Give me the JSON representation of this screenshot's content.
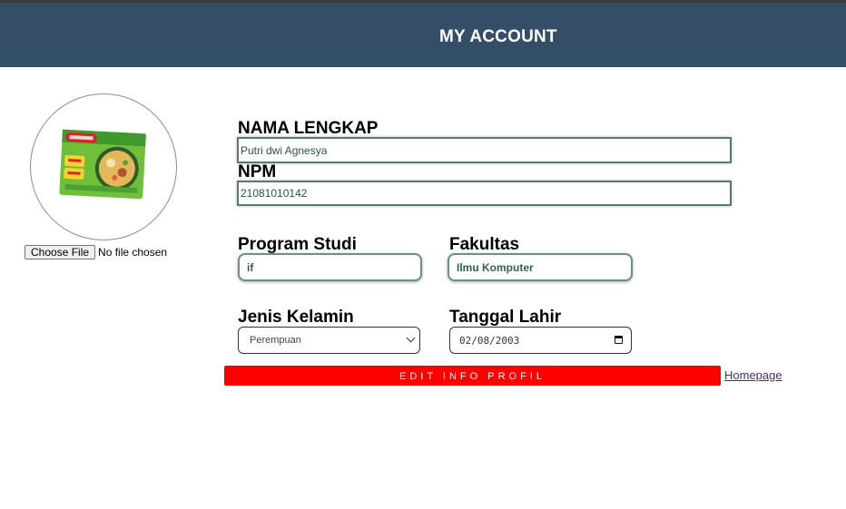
{
  "header": {
    "title": "MY ACCOUNT"
  },
  "profile": {
    "avatar_icon": "instant-noodle-package-image",
    "file_button": "Choose File",
    "file_status": "No file chosen"
  },
  "form": {
    "nama_label": "NAMA LENGKAP",
    "nama_value": "Putri dwi Agnesya",
    "npm_label": "NPM",
    "npm_value": "21081010142",
    "prodi_label": "Program Studi",
    "prodi_value": "if",
    "fakultas_label": "Fakultas",
    "fakultas_value": "Ilmu Komputer",
    "jk_label": "Jenis Kelamin",
    "jk_value": "Perempuan",
    "tgl_label": "Tanggal Lahir",
    "tgl_value": "02/08/2003"
  },
  "actions": {
    "edit_label": "EDIT INFO PROFIL",
    "homepage_label": "Homepage"
  },
  "colors": {
    "header_bg": "#344e68",
    "edit_button": "#ff0000",
    "link": "#4b2a7a"
  }
}
